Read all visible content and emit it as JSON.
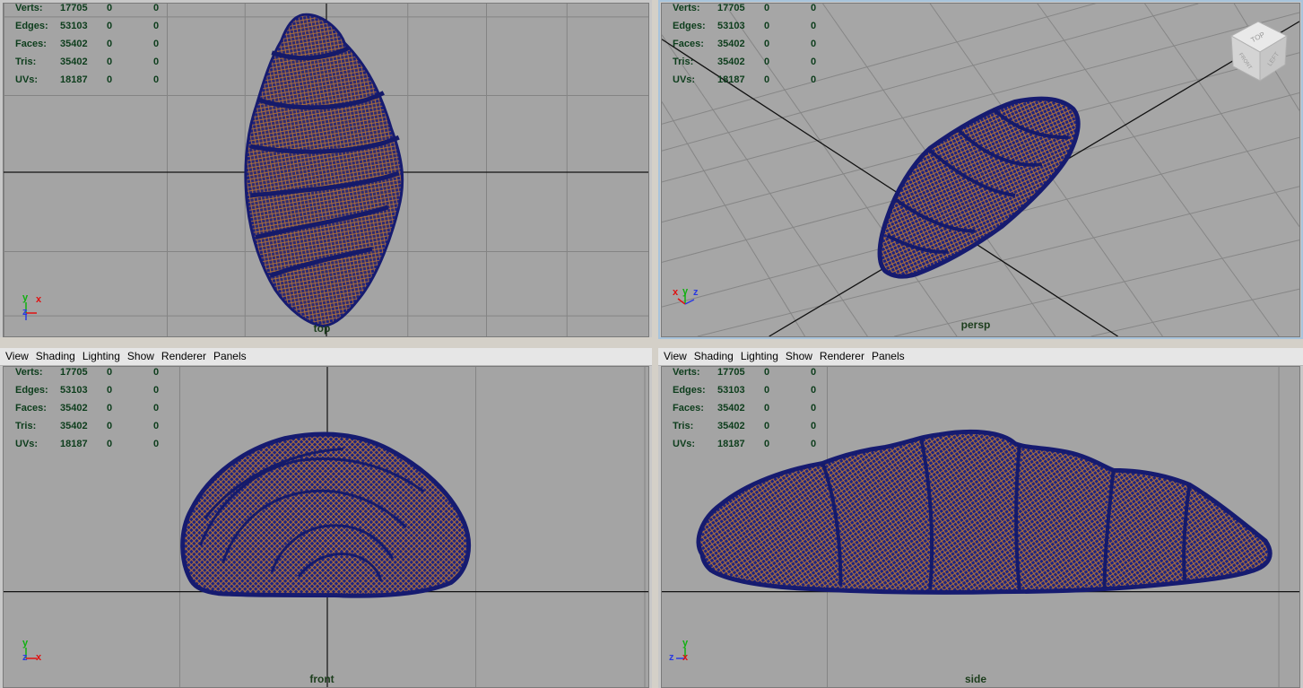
{
  "stats_labels": {
    "verts": "Verts:",
    "edges": "Edges:",
    "faces": "Faces:",
    "tris": "Tris:",
    "uvs": "UVs:"
  },
  "stats_values": {
    "verts": "17705",
    "edges": "53103",
    "faces": "35402",
    "tris": "35402",
    "uvs": "18187",
    "zero": "0"
  },
  "menu": {
    "view": "View",
    "shading": "Shading",
    "lighting": "Lighting",
    "show": "Show",
    "renderer": "Renderer",
    "panels": "Panels"
  },
  "panes": {
    "top": {
      "camera": "top"
    },
    "persp": {
      "camera": "persp"
    },
    "front": {
      "camera": "front"
    },
    "side": {
      "camera": "side"
    }
  },
  "axes": {
    "x": "x",
    "y": "y",
    "z": "z"
  },
  "viewcube": {
    "top": "TOP",
    "left": "LEFT",
    "front": "FRONT"
  },
  "colors": {
    "viewport_bg": "#a4a4a4",
    "grid": "#838383",
    "axis_line": "#1a1a1a",
    "wire": "#1a1f7a",
    "wire_dark": "#14185e",
    "fill": "#b8702e",
    "hud": "#0d3d1c",
    "active_border": "#a8c4dc"
  }
}
